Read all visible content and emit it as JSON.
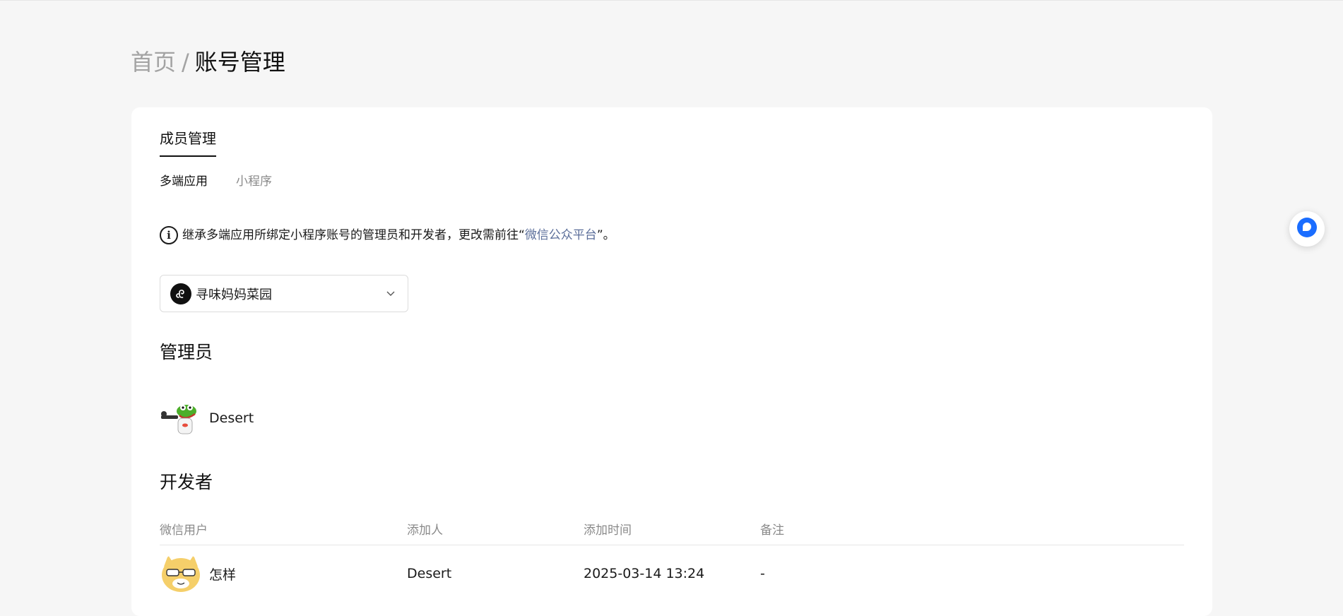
{
  "breadcrumb": {
    "home": "首页",
    "separator": "/",
    "current": "账号管理"
  },
  "tabs": {
    "main": "成员管理",
    "sub": [
      "多端应用",
      "小程序"
    ]
  },
  "notice": {
    "prefix": "继承多端应用所绑定小程序账号的管理员和开发者，更改需前往“",
    "link": "微信公众平台",
    "suffix": "”。"
  },
  "select": {
    "value": "寻味妈妈菜园"
  },
  "admins": {
    "title": "管理员",
    "name": "Desert"
  },
  "developers": {
    "title": "开发者",
    "columns": [
      "微信用户",
      "添加人",
      "添加时间",
      "备注"
    ],
    "rows": [
      {
        "user": "怎样",
        "added_by": "Desert",
        "added_time": "2025-03-14 13:24",
        "note": "-"
      }
    ]
  },
  "colors": {
    "link": "#5b6e9a",
    "float_accent": "#1a6dff",
    "background": "#f6f6f6"
  },
  "icons": {
    "info": "info-icon",
    "select_logo": "mini-program-logo-icon",
    "chevron": "chevron-down-icon",
    "float": "chat-bubble-icon"
  }
}
